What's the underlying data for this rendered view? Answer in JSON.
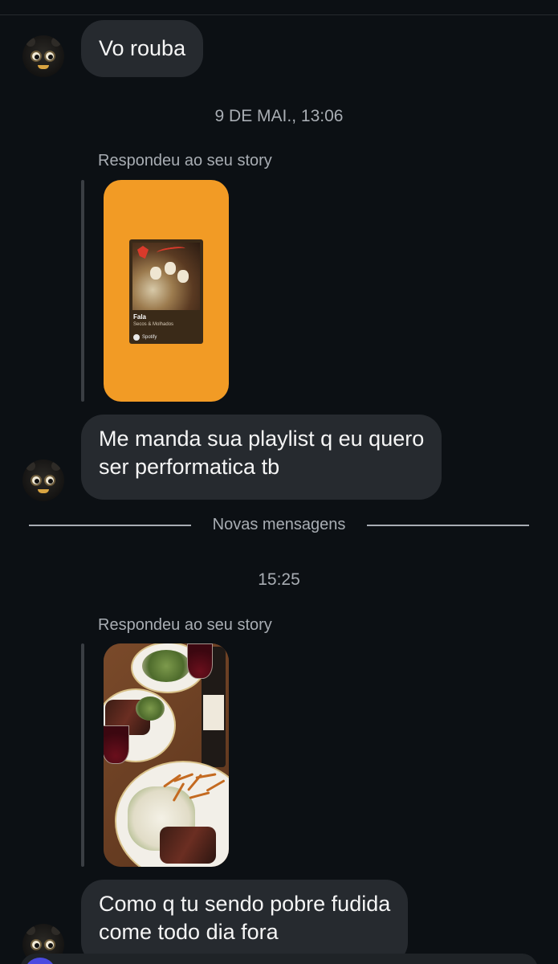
{
  "messages": {
    "m1": {
      "text": "Vo rouba"
    },
    "ts1": {
      "text": "9 DE MAI., 13:06"
    },
    "reply1": {
      "label": "Respondeu ao seu story"
    },
    "story1": {
      "spotify": {
        "title": "Fala",
        "artist": "Secos & Molhados",
        "service": "Spotify"
      }
    },
    "m2": {
      "line1": "Me manda sua playlist q eu quero",
      "line2": "ser performatica tb"
    },
    "divider": {
      "label": "Novas mensagens"
    },
    "ts2": {
      "text": "15:25"
    },
    "reply2": {
      "label": "Respondeu ao seu story"
    },
    "m3": {
      "line1": "Como q tu sendo pobre fudida",
      "line2": "come todo dia fora"
    }
  },
  "colors": {
    "background": "#0c1014",
    "bubble": "#262a2f",
    "muted_text": "#a8adb3",
    "story_orange": "#f29b25"
  },
  "icons": [
    "contact-avatar-icon",
    "spotify-icon"
  ]
}
